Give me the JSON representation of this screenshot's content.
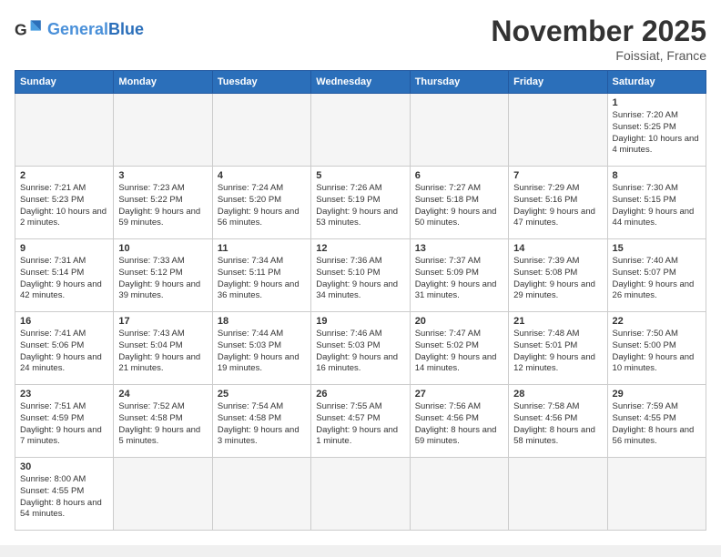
{
  "header": {
    "logo_general": "General",
    "logo_blue": "Blue",
    "month_title": "November 2025",
    "subtitle": "Foissiat, France"
  },
  "days_of_week": [
    "Sunday",
    "Monday",
    "Tuesday",
    "Wednesday",
    "Thursday",
    "Friday",
    "Saturday"
  ],
  "weeks": [
    [
      {
        "day": "",
        "info": ""
      },
      {
        "day": "",
        "info": ""
      },
      {
        "day": "",
        "info": ""
      },
      {
        "day": "",
        "info": ""
      },
      {
        "day": "",
        "info": ""
      },
      {
        "day": "",
        "info": ""
      },
      {
        "day": "1",
        "info": "Sunrise: 7:20 AM\nSunset: 5:25 PM\nDaylight: 10 hours and 4 minutes."
      }
    ],
    [
      {
        "day": "2",
        "info": "Sunrise: 7:21 AM\nSunset: 5:23 PM\nDaylight: 10 hours and 2 minutes."
      },
      {
        "day": "3",
        "info": "Sunrise: 7:23 AM\nSunset: 5:22 PM\nDaylight: 9 hours and 59 minutes."
      },
      {
        "day": "4",
        "info": "Sunrise: 7:24 AM\nSunset: 5:20 PM\nDaylight: 9 hours and 56 minutes."
      },
      {
        "day": "5",
        "info": "Sunrise: 7:26 AM\nSunset: 5:19 PM\nDaylight: 9 hours and 53 minutes."
      },
      {
        "day": "6",
        "info": "Sunrise: 7:27 AM\nSunset: 5:18 PM\nDaylight: 9 hours and 50 minutes."
      },
      {
        "day": "7",
        "info": "Sunrise: 7:29 AM\nSunset: 5:16 PM\nDaylight: 9 hours and 47 minutes."
      },
      {
        "day": "8",
        "info": "Sunrise: 7:30 AM\nSunset: 5:15 PM\nDaylight: 9 hours and 44 minutes."
      }
    ],
    [
      {
        "day": "9",
        "info": "Sunrise: 7:31 AM\nSunset: 5:14 PM\nDaylight: 9 hours and 42 minutes."
      },
      {
        "day": "10",
        "info": "Sunrise: 7:33 AM\nSunset: 5:12 PM\nDaylight: 9 hours and 39 minutes."
      },
      {
        "day": "11",
        "info": "Sunrise: 7:34 AM\nSunset: 5:11 PM\nDaylight: 9 hours and 36 minutes."
      },
      {
        "day": "12",
        "info": "Sunrise: 7:36 AM\nSunset: 5:10 PM\nDaylight: 9 hours and 34 minutes."
      },
      {
        "day": "13",
        "info": "Sunrise: 7:37 AM\nSunset: 5:09 PM\nDaylight: 9 hours and 31 minutes."
      },
      {
        "day": "14",
        "info": "Sunrise: 7:39 AM\nSunset: 5:08 PM\nDaylight: 9 hours and 29 minutes."
      },
      {
        "day": "15",
        "info": "Sunrise: 7:40 AM\nSunset: 5:07 PM\nDaylight: 9 hours and 26 minutes."
      }
    ],
    [
      {
        "day": "16",
        "info": "Sunrise: 7:41 AM\nSunset: 5:06 PM\nDaylight: 9 hours and 24 minutes."
      },
      {
        "day": "17",
        "info": "Sunrise: 7:43 AM\nSunset: 5:04 PM\nDaylight: 9 hours and 21 minutes."
      },
      {
        "day": "18",
        "info": "Sunrise: 7:44 AM\nSunset: 5:03 PM\nDaylight: 9 hours and 19 minutes."
      },
      {
        "day": "19",
        "info": "Sunrise: 7:46 AM\nSunset: 5:03 PM\nDaylight: 9 hours and 16 minutes."
      },
      {
        "day": "20",
        "info": "Sunrise: 7:47 AM\nSunset: 5:02 PM\nDaylight: 9 hours and 14 minutes."
      },
      {
        "day": "21",
        "info": "Sunrise: 7:48 AM\nSunset: 5:01 PM\nDaylight: 9 hours and 12 minutes."
      },
      {
        "day": "22",
        "info": "Sunrise: 7:50 AM\nSunset: 5:00 PM\nDaylight: 9 hours and 10 minutes."
      }
    ],
    [
      {
        "day": "23",
        "info": "Sunrise: 7:51 AM\nSunset: 4:59 PM\nDaylight: 9 hours and 7 minutes."
      },
      {
        "day": "24",
        "info": "Sunrise: 7:52 AM\nSunset: 4:58 PM\nDaylight: 9 hours and 5 minutes."
      },
      {
        "day": "25",
        "info": "Sunrise: 7:54 AM\nSunset: 4:58 PM\nDaylight: 9 hours and 3 minutes."
      },
      {
        "day": "26",
        "info": "Sunrise: 7:55 AM\nSunset: 4:57 PM\nDaylight: 9 hours and 1 minute."
      },
      {
        "day": "27",
        "info": "Sunrise: 7:56 AM\nSunset: 4:56 PM\nDaylight: 8 hours and 59 minutes."
      },
      {
        "day": "28",
        "info": "Sunrise: 7:58 AM\nSunset: 4:56 PM\nDaylight: 8 hours and 58 minutes."
      },
      {
        "day": "29",
        "info": "Sunrise: 7:59 AM\nSunset: 4:55 PM\nDaylight: 8 hours and 56 minutes."
      }
    ],
    [
      {
        "day": "30",
        "info": "Sunrise: 8:00 AM\nSunset: 4:55 PM\nDaylight: 8 hours and 54 minutes."
      },
      {
        "day": "",
        "info": ""
      },
      {
        "day": "",
        "info": ""
      },
      {
        "day": "",
        "info": ""
      },
      {
        "day": "",
        "info": ""
      },
      {
        "day": "",
        "info": ""
      },
      {
        "day": "",
        "info": ""
      }
    ]
  ]
}
